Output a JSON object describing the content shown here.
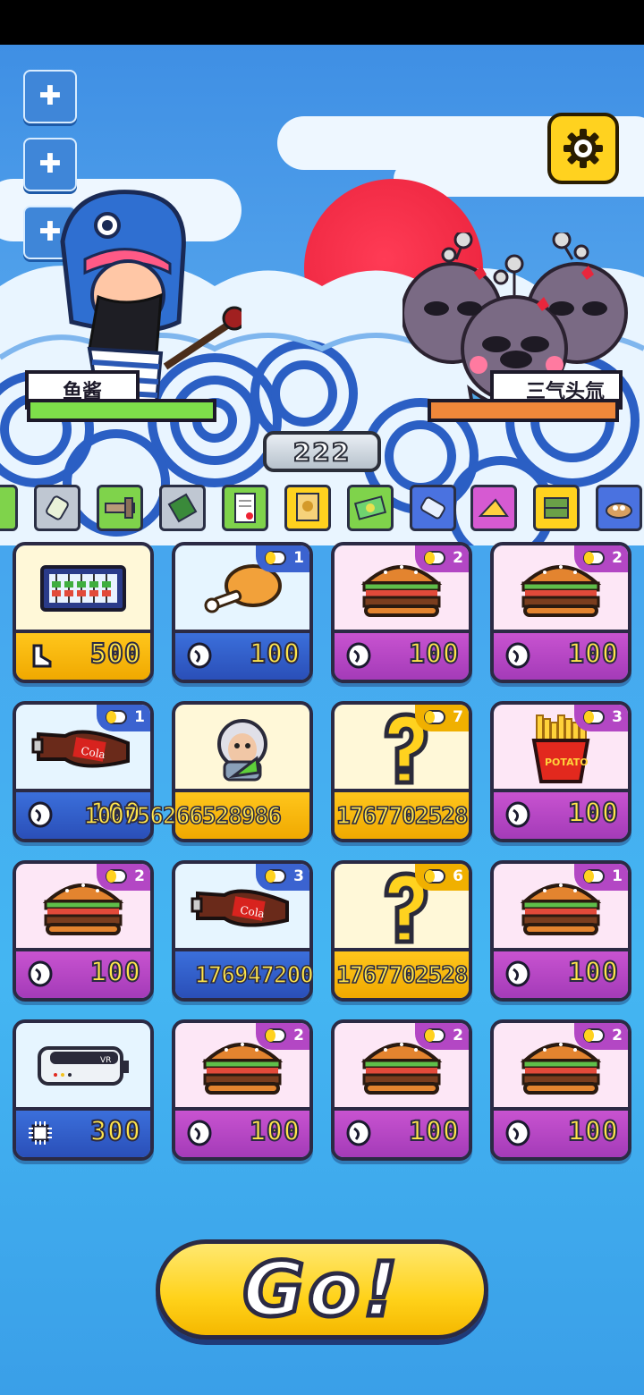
{
  "header": {
    "side_buttons": [
      "plus-icon",
      "plus-icon",
      "plus-icon"
    ],
    "settings_icon": "gear-icon"
  },
  "battle": {
    "player_name": "鱼酱",
    "enemy_name": "三气头氚",
    "score": "222",
    "player_hp_color": "#7ee04a",
    "enemy_hp_color": "#f0883a"
  },
  "item_strip": [
    {
      "icon": "partial-item-icon",
      "color": "#7fd34b"
    },
    {
      "icon": "bottle-icon",
      "color": "#bfc7d2"
    },
    {
      "icon": "tool-icon",
      "color": "#7fd34b"
    },
    {
      "icon": "circuit-board-icon",
      "color": "#bfc7d2"
    },
    {
      "icon": "document-icon",
      "color": "#7fd34b"
    },
    {
      "icon": "certificate-icon",
      "color": "#ffd21f"
    },
    {
      "icon": "money-icon",
      "color": "#7fd34b"
    },
    {
      "icon": "canister-icon",
      "color": "#4a72e0"
    },
    {
      "icon": "cheese-icon",
      "color": "#d65ad2"
    },
    {
      "icon": "crate-icon",
      "color": "#ffd21f"
    },
    {
      "icon": "nest-icon",
      "color": "#4a72e0"
    }
  ],
  "cards": [
    {
      "item": "abacus-icon",
      "price": "500",
      "currency": "boot-icon",
      "theme": "yellow",
      "badge": ""
    },
    {
      "item": "chicken-leg-icon",
      "price": "100",
      "currency": "bean-icon",
      "theme": "blue",
      "badge": "1"
    },
    {
      "item": "burger-icon",
      "price": "100",
      "currency": "bean-icon",
      "theme": "pink",
      "badge": "2"
    },
    {
      "item": "burger-icon",
      "price": "100",
      "currency": "bean-icon",
      "theme": "pink",
      "badge": "2"
    },
    {
      "item": "cola-bottle-icon",
      "price": "100",
      "currency": "bean-icon",
      "theme": "blue",
      "badge": "1"
    },
    {
      "item": "scientist-icon",
      "price": "",
      "currency": "",
      "theme": "yellow",
      "badge": ""
    },
    {
      "item": "question-mark-icon",
      "price": "",
      "currency": "",
      "theme": "yellow",
      "badge": "7"
    },
    {
      "item": "fries-icon",
      "price": "100",
      "currency": "bean-icon",
      "theme": "pink",
      "badge": "3"
    },
    {
      "item": "burger-icon",
      "price": "100",
      "currency": "bean-icon",
      "theme": "pink",
      "badge": "2"
    },
    {
      "item": "cola-bottle-icon",
      "price": "",
      "currency": "",
      "theme": "blue",
      "badge": "3"
    },
    {
      "item": "question-mark-icon",
      "price": "",
      "currency": "",
      "theme": "yellow",
      "badge": "6"
    },
    {
      "item": "burger-icon",
      "price": "100",
      "currency": "bean-icon",
      "theme": "pink",
      "badge": "1"
    },
    {
      "item": "vr-headset-icon",
      "price": "300",
      "currency": "chip-icon",
      "theme": "blue",
      "badge": ""
    },
    {
      "item": "burger-icon",
      "price": "100",
      "currency": "bean-icon",
      "theme": "pink",
      "badge": "2"
    },
    {
      "item": "burger-icon",
      "price": "100",
      "currency": "bean-icon",
      "theme": "pink",
      "badge": "2"
    },
    {
      "item": "burger-icon",
      "price": "100",
      "currency": "bean-icon",
      "theme": "pink",
      "badge": "2"
    }
  ],
  "overlay_numbers": {
    "row2_a": "100756266528986",
    "row2_b": "1767702528",
    "row3_a": "176947200",
    "row3_b": "1767702528"
  },
  "go_button": {
    "label": "Go!"
  }
}
